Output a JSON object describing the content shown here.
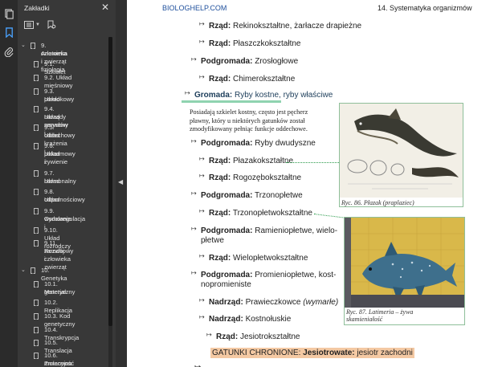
{
  "panel": {
    "title": "Zakładki",
    "close_label": "✕"
  },
  "bookmarks": [
    {
      "label": "9. Anatomia i fizjologia",
      "label2": "człowieka i zwierząt",
      "level": 0,
      "expanded": true
    },
    {
      "label": "9.1. Szkielet",
      "level": 1
    },
    {
      "label": "9.2. Układ mięśniowy",
      "level": 1
    },
    {
      "label": "9.3. Układ",
      "label2": "powłokowy",
      "level": 1
    },
    {
      "label": "9.4. Układ nerwowy i",
      "label2": "narządy zmysłów",
      "level": 1
    },
    {
      "label": "9.5. Układ krążenia i",
      "label2": "oddechowy",
      "level": 1
    },
    {
      "label": "9.6. Układ",
      "label2": "pokarmowy i",
      "label3": "żywienie",
      "level": 1
    },
    {
      "label": "9.7. Układ",
      "label2": "hormonalny",
      "level": 1
    },
    {
      "label": "9.8. Układ",
      "label2": "odpornościowy",
      "level": 1
    },
    {
      "label": "9.9. Osmoregulacja i",
      "label2": "wydalanie",
      "level": 1
    },
    {
      "label": "9.10. Układ rozrodczy",
      "level": 1
    },
    {
      "label": "9.11. Rozwój",
      "label2": "zarodkowy człowieka",
      "label3": "i zwierząt",
      "level": 1
    },
    {
      "label": "10. Genetyka",
      "level": 0,
      "expanded": true
    },
    {
      "label": "10.1. Materiał",
      "label2": "genetyczny",
      "level": 1
    },
    {
      "label": "10.2. Replikacja",
      "level": 1
    },
    {
      "label": "10.3. Kod genetyczny",
      "level": 1
    },
    {
      "label": "10.4. Transkrypcja",
      "level": 1
    },
    {
      "label": "10.5. Translacja",
      "level": 1
    },
    {
      "label": "10.6. Zmienność",
      "label2": "mutacyjna",
      "level": 1
    }
  ],
  "page": {
    "header_left": "BIOLOGHELP.COM",
    "header_right": "14. Systematyka organizmów",
    "rows": [
      {
        "bold": "Rząd:",
        "text": " Rekinokształtne, żarłacze drapieżne"
      },
      {
        "bold": "Rząd:",
        "text": " Płaszczkokształtne"
      },
      {
        "bold": "Podgromada:",
        "text": " Zrosłogłowe"
      },
      {
        "bold": "Rząd:",
        "text": " Chimerokształtne"
      },
      {
        "bold": "Gromada:",
        "text": " Ryby kostne, ryby właściwe"
      },
      {
        "bold": "Podgromada:",
        "text": " Ryby dwudyszne"
      },
      {
        "bold": "Rząd:",
        "text": " Płazakokształtne"
      },
      {
        "bold": "Rząd:",
        "text": " Rogozębokształtne"
      },
      {
        "bold": "Podgromada:",
        "text": " Trzonopłetwe"
      },
      {
        "bold": "Rząd:",
        "text": " Trzonopłetwokształtne"
      },
      {
        "bold": "Podgromada:",
        "text": "  Ramieniopłetwe,  wielo-",
        "text2": "płetwe"
      },
      {
        "bold": "Rząd:",
        "text": " Wielopłetwokształtne"
      },
      {
        "bold": "Podgromada:",
        "text": "  Promieniopłetwe,  kost-",
        "text2": "nopromieniste"
      },
      {
        "bold": "Nadrząd:",
        "text": " Prawieczkowce ",
        "italic": "(wymarłe)"
      },
      {
        "bold": "Nadrząd:",
        "text": " Kostnołuskie"
      },
      {
        "bold": "Rząd:",
        "text": " Jesiotrokształtne"
      }
    ],
    "paragraph": "Posiadają szkielet kostny, często jest pęcherz pławny, który u niektórych gatunków został zmodyfikowany pełniąc funkcje oddechowe.",
    "highlight_prefix": "GATUNKI CHRONIONE: ",
    "highlight_bold": "Jesiotrowate:",
    "highlight_text": " jesiotr zachodni",
    "fig1_caption": "Ryc. 86. Płazak (praplaziec)",
    "fig2_caption_line1": "Ryc. 87. Latimeria – żywa",
    "fig2_caption_line2": "skamieniałość"
  }
}
